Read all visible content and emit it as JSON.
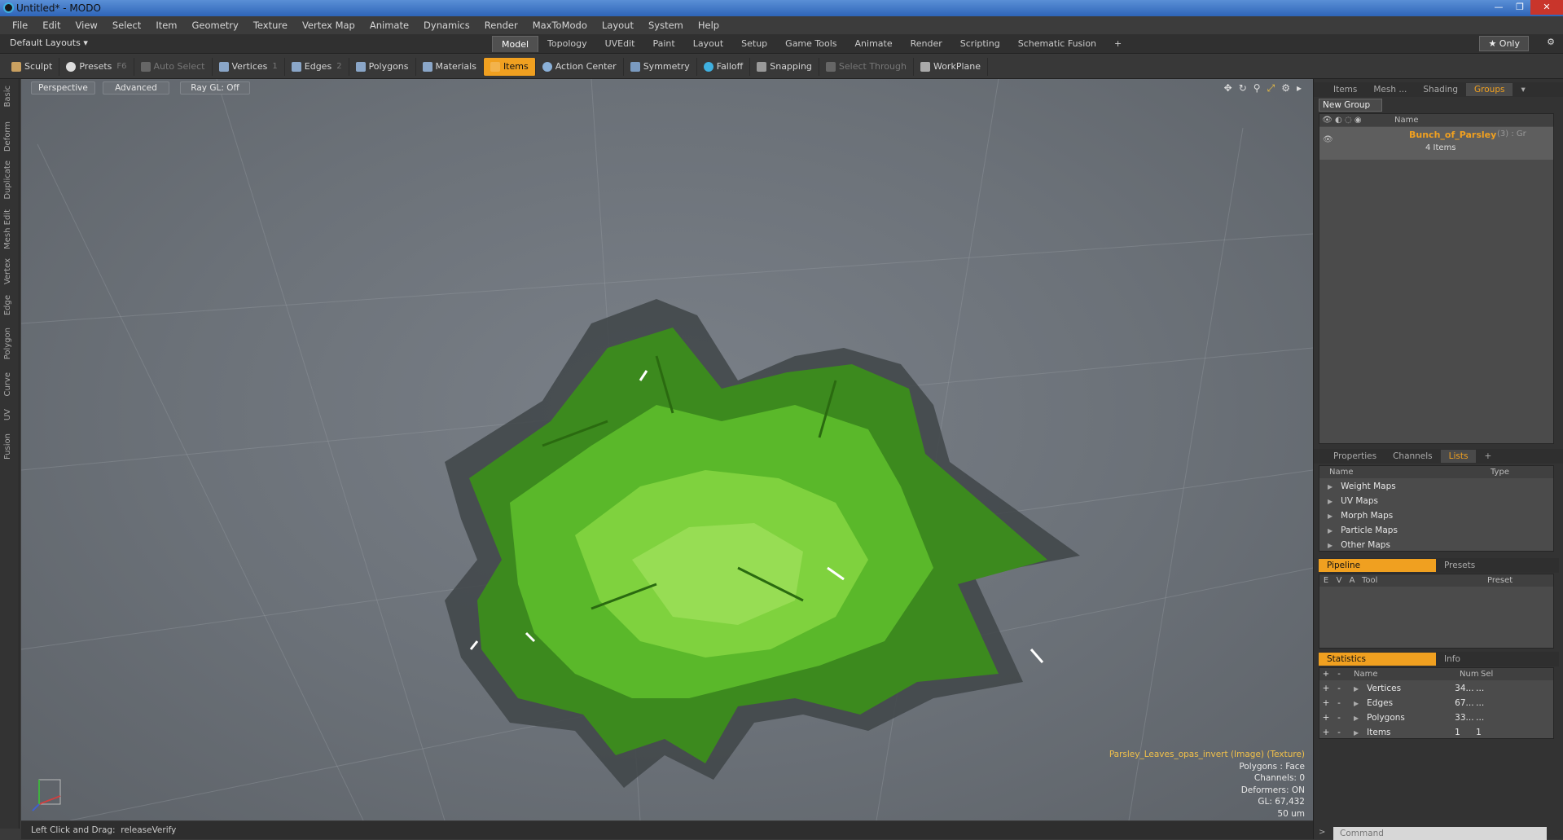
{
  "window": {
    "title": "Untitled* - MODO"
  },
  "menu": [
    "File",
    "Edit",
    "View",
    "Select",
    "Item",
    "Geometry",
    "Texture",
    "Vertex Map",
    "Animate",
    "Dynamics",
    "Render",
    "MaxToModo",
    "Layout",
    "System",
    "Help"
  ],
  "layoutbar": {
    "default_layouts": "Default Layouts",
    "tabs": [
      "Model",
      "Topology",
      "UVEdit",
      "Paint",
      "Layout",
      "Setup",
      "Game Tools",
      "Animate",
      "Render",
      "Scripting",
      "Schematic Fusion"
    ],
    "active_tab": "Model",
    "add": "+",
    "only": "Only"
  },
  "toolbar": {
    "sculpt": "Sculpt",
    "presets": "Presets",
    "presets_key": "F6",
    "auto_select": "Auto Select",
    "vertices": "Vertices",
    "vertices_key": "1",
    "edges": "Edges",
    "edges_key": "2",
    "polygons": "Polygons",
    "materials": "Materials",
    "items": "Items",
    "action_center": "Action Center",
    "symmetry": "Symmetry",
    "falloff": "Falloff",
    "snapping": "Snapping",
    "select_through": "Select Through",
    "workplane": "WorkPlane"
  },
  "left_tabs": [
    "Basic",
    "Deform",
    "Duplicate",
    "Mesh Edit",
    "Vertex",
    "Edge",
    "Polygon",
    "Curve",
    "UV",
    "Fusion"
  ],
  "viewport": {
    "view": "Perspective",
    "shading": "Advanced",
    "raygl": "Ray GL: Off",
    "info": {
      "texture": "Parsley_Leaves_opas_invert (Image) (Texture)",
      "polygons": "Polygons : Face",
      "channels": "Channels: 0",
      "deformers": "Deformers: ON",
      "gl": "GL: 67,432",
      "scale": "50 um"
    }
  },
  "status": {
    "left_click": "Left Click and Drag:",
    "action": "releaseVerify"
  },
  "right": {
    "top_tabs": [
      "Items",
      "Mesh ...",
      "Shading",
      "Groups"
    ],
    "active_top_tab": "Groups",
    "new_group": "New Group",
    "groups_col_name": "Name",
    "group_name": "Bunch_of_Parsley",
    "group_suffix": "(3) : Gr",
    "group_count": "4 Items",
    "mid_tabs": [
      "Properties",
      "Channels",
      "Lists"
    ],
    "active_mid_tab": "Lists",
    "mid_add": "+",
    "lists_col_name": "Name",
    "lists_col_type": "Type",
    "lists": [
      "Weight Maps",
      "UV Maps",
      "Morph Maps",
      "Particle Maps",
      "Other Maps"
    ],
    "pipeline_tab": "Pipeline",
    "presets_tab": "Presets",
    "pipeline_cols": [
      "E",
      "V",
      "A",
      "Tool",
      "Preset"
    ],
    "stats_tab": "Statistics",
    "info_tab": "Info",
    "stats_cols": {
      "plus": "+",
      "minus": "-",
      "name": "Name",
      "num": "Num",
      "sel": "Sel"
    },
    "stats": [
      {
        "name": "Vertices",
        "num": "34...",
        "sel": "..."
      },
      {
        "name": "Edges",
        "num": "67...",
        "sel": "..."
      },
      {
        "name": "Polygons",
        "num": "33...",
        "sel": "..."
      },
      {
        "name": "Items",
        "num": "1",
        "sel": "1"
      }
    ],
    "command_placeholder": "Command"
  }
}
